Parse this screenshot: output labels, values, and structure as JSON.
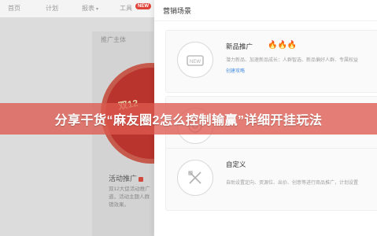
{
  "topnav": {
    "items": [
      "首页",
      "计划",
      "报表",
      "工具"
    ],
    "badge": "NEW"
  },
  "background": {
    "panel_title": "推广主体",
    "promo_text": "双12",
    "activity_label": "活动推广",
    "activity_desc": "双12大促活动推广\n道，活动主题人群\n销效果。"
  },
  "modal": {
    "title": "营销场景",
    "scenes": [
      {
        "name": "新品推广",
        "icon": "new-tag-icon",
        "desc": "潜力新品、加速新品成长：人群智选、新品偏好人群、专属权益",
        "link": "创建攻略"
      },
      {
        "name": "",
        "icon": "target-icon",
        "desc": "",
        "link": ""
      },
      {
        "name": "自定义",
        "icon": "tools-icon",
        "desc": "自助设置定向、资源位、出价、创意等进行商品推广，计划设置",
        "link": ""
      }
    ]
  },
  "banner": {
    "text": "分享干货“麻友圈2怎么控制输赢”详细开挂玩法"
  },
  "colors": {
    "accent": "#4a90e2",
    "banner": "#dc5a50",
    "badge": "#e0433a"
  }
}
